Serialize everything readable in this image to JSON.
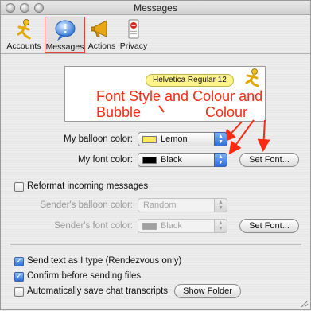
{
  "window": {
    "title": "Messages"
  },
  "toolbar": {
    "items": [
      {
        "label": "Accounts",
        "icon": "aim-running-man-icon"
      },
      {
        "label": "Messages",
        "icon": "speech-bubble-icon",
        "selected": true
      },
      {
        "label": "Actions",
        "icon": "megaphone-icon"
      },
      {
        "label": "Privacy",
        "icon": "no-entry-sign-icon"
      }
    ]
  },
  "preview": {
    "bubble_text": "Helvetica Regular 12"
  },
  "annotations": {
    "line1": "Font Style and Colour and",
    "line2": "Bubble",
    "line3": "Colour",
    "color": "#ff2a12"
  },
  "my_settings": {
    "balloon_label": "My balloon color:",
    "balloon_value": "Lemon",
    "balloon_color": "#ffe85a",
    "font_label": "My font color:",
    "font_value": "Black",
    "font_color": "#000000",
    "set_font_label": "Set Font..."
  },
  "reformat": {
    "checkbox_label": "Reformat incoming messages",
    "checked": false,
    "sender_balloon_label": "Sender's balloon color:",
    "sender_balloon_value": "Random",
    "sender_font_label": "Sender's font color:",
    "sender_font_value": "Black",
    "sender_font_swatch": "#a0a0a0",
    "set_font_label": "Set Font..."
  },
  "options": {
    "send_as_type_label": "Send text as I type (Rendezvous only)",
    "send_as_type_checked": true,
    "confirm_label": "Confirm before sending files",
    "confirm_checked": true,
    "save_transcripts_label": "Automatically save chat transcripts",
    "save_transcripts_checked": false,
    "show_folder_label": "Show Folder"
  }
}
